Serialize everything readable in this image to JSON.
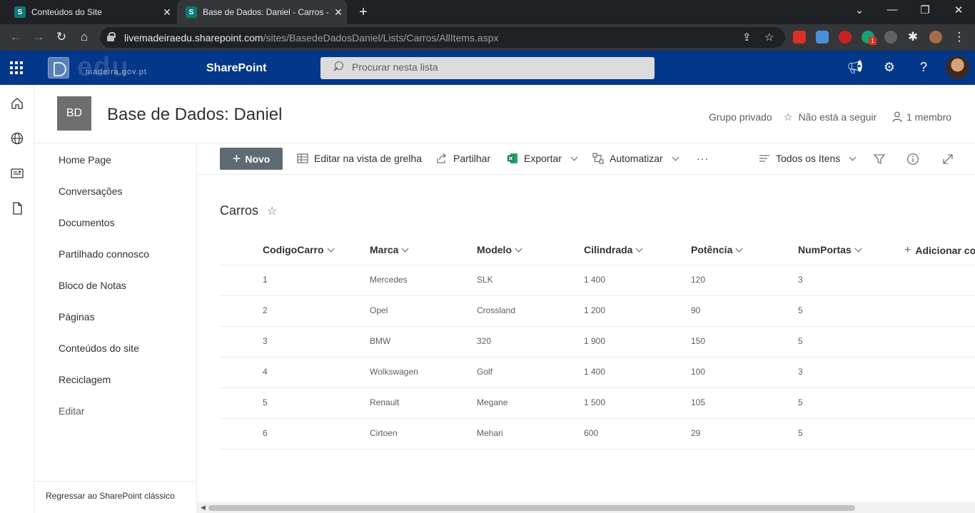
{
  "browser": {
    "tabs": [
      {
        "favicon": "S",
        "title": "Conteúdos do Site"
      },
      {
        "favicon": "S",
        "title": "Base de Dados: Daniel - Carros - "
      }
    ],
    "url_host": "livemadeiraedu.sharepoint.com",
    "url_path": "/sites/BasedeDadosDaniel/Lists/Carros/AllItems.aspx",
    "extension_badge": "1"
  },
  "suite": {
    "brand_logo_text": "edu",
    "brand_logo_sub": "madeira.gov.pt",
    "app_name": "SharePoint",
    "search_placeholder": "Procurar nesta lista"
  },
  "site": {
    "logo_initials": "BD",
    "title": "Base de Dados: Daniel",
    "privacy": "Grupo privado",
    "follow_label": "Não está a seguir",
    "members_label": "1 membro"
  },
  "nav": {
    "items": [
      "Home Page",
      "Conversações",
      "Documentos",
      "Partilhado connosco",
      "Bloco de Notas",
      "Páginas",
      "Conteúdos do site",
      "Reciclagem"
    ],
    "edit_label": "Editar",
    "footer_label": "Regressar ao SharePoint clássico"
  },
  "commands": {
    "new_label": "Novo",
    "grid_edit_label": "Editar na vista de grelha",
    "share_label": "Partilhar",
    "export_label": "Exportar",
    "automate_label": "Automatizar",
    "more_label": "···",
    "view_label": "Todos os Itens"
  },
  "list": {
    "title": "Carros",
    "columns": [
      "CodigoCarro",
      "Marca",
      "Modelo",
      "Cilindrada",
      "Potência",
      "NumPortas"
    ],
    "add_column_label": "Adicionar col",
    "rows": [
      [
        "1",
        "Mercedes",
        "SLK",
        "1 400",
        "120",
        "3"
      ],
      [
        "2",
        "Opel",
        "Crossland",
        "1 200",
        "90",
        "5"
      ],
      [
        "3",
        "BMW",
        "320",
        "1 900",
        "150",
        "5"
      ],
      [
        "4",
        "Wolkswagen",
        "Golf",
        "1 400",
        "100",
        "3"
      ],
      [
        "5",
        "Renault",
        "Megane",
        "1 500",
        "105",
        "5"
      ],
      [
        "6",
        "Cirtoen",
        "Mehari",
        "600",
        "29",
        "5"
      ]
    ]
  },
  "colors": {
    "suite_bar": "#03378a",
    "new_button": "#5f6b73",
    "chrome_dark": "#202124"
  }
}
